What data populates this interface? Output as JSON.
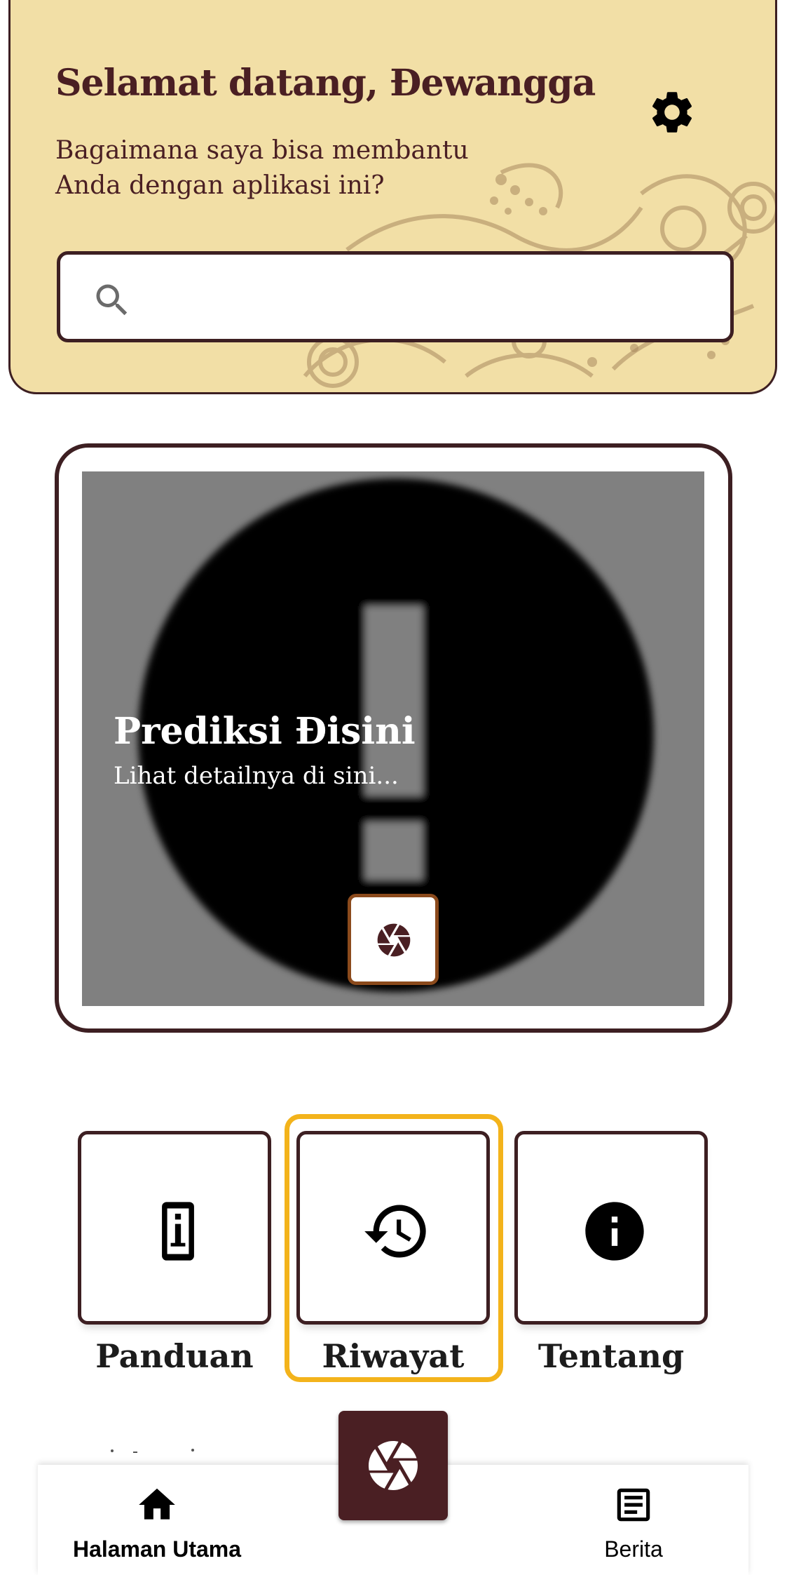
{
  "header": {
    "welcome": "Selamat datang, Đewangga",
    "subtitle": "Bagaimana saya bisa membantu Anda dengan aplikasi ini?",
    "settings_icon": "gear-icon"
  },
  "search": {
    "placeholder": "",
    "value": "",
    "icon": "search-icon"
  },
  "prediction": {
    "title": "Prediksi Đisini",
    "subtitle": "Lihat detailnya di sini...",
    "image_icon": "error-exclamation-icon",
    "camera_icon": "camera-aperture-icon"
  },
  "menu": {
    "items": [
      {
        "label": "Panduan",
        "icon": "guide-phone-info-icon"
      },
      {
        "label": "Riwayat",
        "icon": "history-icon"
      },
      {
        "label": "Tentang",
        "icon": "info-icon"
      }
    ]
  },
  "bottom_nav": {
    "items": [
      {
        "label": "Halaman Utama",
        "icon": "home-icon",
        "active": true
      },
      {
        "label": "Berita",
        "icon": "article-icon",
        "active": false
      }
    ],
    "fab_icon": "camera-aperture-icon"
  },
  "colors": {
    "header_bg": "#f2dfa6",
    "primary_dark": "#4a1f23",
    "highlight": "#f3b31b",
    "camera_border": "#8b4a1c"
  }
}
